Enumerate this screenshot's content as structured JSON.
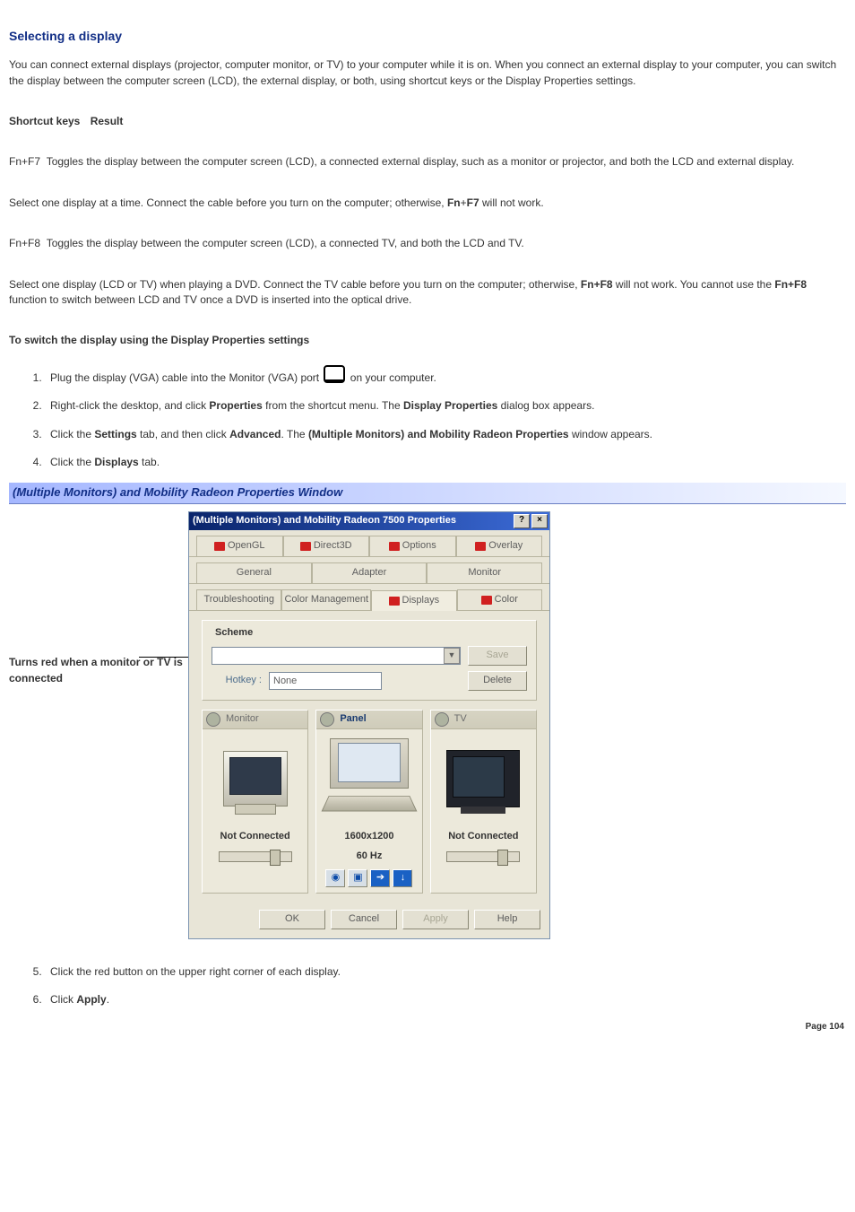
{
  "heading": "Selecting a display",
  "intro": "You can connect external displays (projector, computer monitor, or TV) to your computer while it is on. When you connect an external display to your computer, you can switch the display between the computer screen (LCD), the external display, or both, using shortcut keys or the Display Properties settings.",
  "shortcut_table": {
    "col1": "Shortcut keys",
    "col2": "Result"
  },
  "fnf7": {
    "key": "Fn+F7",
    "desc": "Toggles the display between the computer screen (LCD), a connected external display, such as a monitor or projector, and both the LCD and external display."
  },
  "fnf7_note_pre": "Select one display at a time. Connect the cable before you turn on the computer; otherwise, ",
  "fnf7_note_post": " will not work.",
  "fn_plus": "Fn",
  "plus": "+",
  "f7": "F7",
  "fnf8": {
    "key": "Fn+F8",
    "desc": "Toggles the display between the computer screen (LCD), a connected TV, and both the LCD and TV."
  },
  "fnf8_note_pre": "Select one display (LCD or TV) when playing a DVD. Connect the TV cable before you turn on the computer; otherwise, ",
  "fnf8_bold1": "Fn+F8",
  "fnf8_note_mid": " will not work. You cannot use the ",
  "fnf8_bold2": "Fn+F8",
  "fnf8_note_post": " function to switch between LCD and TV once a DVD is inserted into the optical drive.",
  "subheading": "To switch the display using the Display Properties settings",
  "steps": {
    "s1_pre": "Plug the display (VGA) cable into the Monitor (VGA) port ",
    "s1_post": " on your computer.",
    "s2_pre": "Right-click the desktop, and click ",
    "s2_b1": "Properties",
    "s2_mid": " from the shortcut menu. The ",
    "s2_b2": "Display Properties",
    "s2_post": " dialog box appears.",
    "s3_pre": "Click the ",
    "s3_b1": "Settings",
    "s3_mid1": " tab, and then click ",
    "s3_b2": "Advanced",
    "s3_mid2": ". The ",
    "s3_b3": "(Multiple Monitors) and Mobility Radeon Properties",
    "s3_post": " window appears.",
    "s4_pre": "Click the ",
    "s4_b1": "Displays",
    "s4_post": " tab.",
    "s5": "Click the red button on the upper right corner of each display.",
    "s6_pre": "Click ",
    "s6_b1": "Apply",
    "s6_post": "."
  },
  "caption": "(Multiple Monitors) and Mobility Radeon Properties Window",
  "annotation": "Turns red when a monitor or TV is connected",
  "dialog": {
    "title": "(Multiple Monitors) and Mobility Radeon 7500 Properties",
    "help_btn": "?",
    "close_btn": "×",
    "tabs_row1": [
      "OpenGL",
      "Direct3D",
      "Options",
      "Overlay"
    ],
    "tabs_row2": [
      "General",
      "Adapter",
      "Monitor"
    ],
    "tabs_row3": [
      "Troubleshooting",
      "Color Management",
      "Displays",
      "Color"
    ],
    "scheme_label": "Scheme",
    "save_btn": "Save",
    "hotkey_label": "Hotkey :",
    "hotkey_value": "None",
    "delete_btn": "Delete",
    "monitor": {
      "tab": "Monitor",
      "status": "Not Connected"
    },
    "panel": {
      "tab": "Panel",
      "res": "1600x1200",
      "hz": "60 Hz"
    },
    "tv": {
      "tab": "TV",
      "status": "Not Connected"
    },
    "ok": "OK",
    "cancel": "Cancel",
    "apply": "Apply",
    "helpb": "Help"
  },
  "page_num": "Page 104"
}
